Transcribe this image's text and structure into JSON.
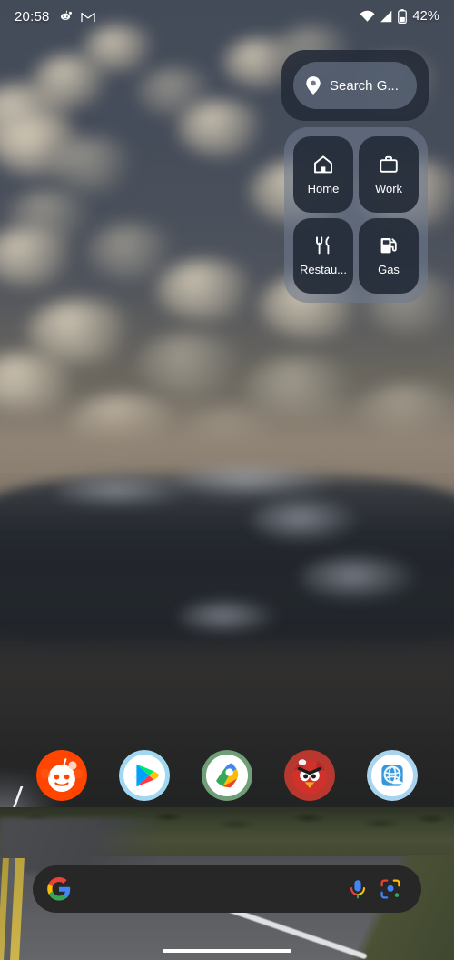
{
  "status_bar": {
    "time": "20:58",
    "battery_percent": "42%",
    "left_icons": [
      "reddit-icon",
      "gmail-icon"
    ],
    "right_icons": [
      "wifi-icon",
      "cellular-signal-icon",
      "battery-icon"
    ]
  },
  "maps_widget": {
    "search": {
      "text": "Search G...",
      "placeholder": "Search Google Maps",
      "icon": "location-pin-icon"
    },
    "shortcuts": [
      {
        "label": "Home",
        "icon": "home-icon",
        "name": "shortcut-home"
      },
      {
        "label": "Work",
        "icon": "briefcase-icon",
        "name": "shortcut-work"
      },
      {
        "label": "Restau...",
        "icon": "restaurant-icon",
        "name": "shortcut-restaurants"
      },
      {
        "label": "Gas",
        "icon": "gas-pump-icon",
        "name": "shortcut-gas"
      }
    ]
  },
  "dock": {
    "apps": [
      {
        "label": "Reddit",
        "icon": "reddit-app-icon"
      },
      {
        "label": "Play Store",
        "icon": "play-store-app-icon"
      },
      {
        "label": "Maps",
        "icon": "google-maps-app-icon"
      },
      {
        "label": "Angry Birds",
        "icon": "angry-birds-app-icon"
      },
      {
        "label": "Weather",
        "icon": "weather-app-icon"
      }
    ]
  },
  "search_bar": {
    "logo": "google-g-icon",
    "value": "",
    "placeholder": "",
    "voice_icon": "microphone-icon",
    "lens_icon": "google-lens-icon"
  },
  "navigation": {
    "gesture_bar": "home-gesture-bar"
  },
  "colors": {
    "widget_card_dark": "#262d3a",
    "widget_card_light": "#6e7a8d",
    "search_bar_bg": "#272727",
    "text_primary": "#ffffff"
  }
}
